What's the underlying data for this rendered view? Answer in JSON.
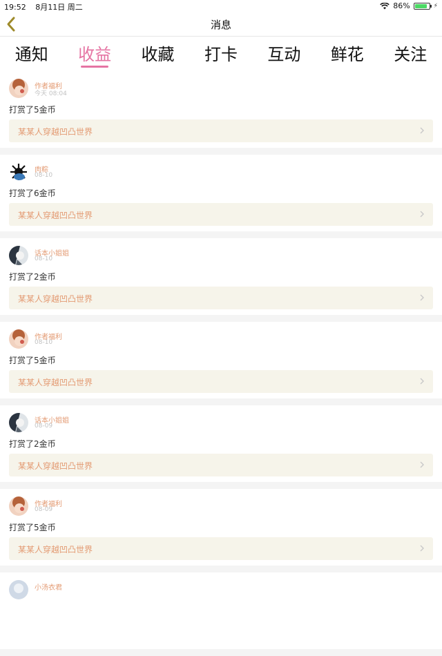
{
  "status": {
    "time": "19:52",
    "date": "8月11日 周二",
    "battery": "86%"
  },
  "nav": {
    "title": "消息",
    "back_icon": "chevron-left-icon"
  },
  "tabs": [
    {
      "label": "通知"
    },
    {
      "label": "收益"
    },
    {
      "label": "收藏"
    },
    {
      "label": "打卡"
    },
    {
      "label": "互动"
    },
    {
      "label": "鲜花"
    },
    {
      "label": "关注"
    }
  ],
  "active_tab": "收益",
  "colors": {
    "accent": "#e574a3",
    "name": "#e39a72",
    "book_bg": "#f6f4ea",
    "battery": "#4cd964"
  },
  "items": [
    {
      "name": "作者福利",
      "time": "今天 08:04",
      "text": "打赏了5金币",
      "book": "某某人穿越凹凸世界"
    },
    {
      "name": "肉粽",
      "time": "08-10",
      "text": "打赏了6金币",
      "book": "某某人穿越凹凸世界"
    },
    {
      "name": "话本小姐姐",
      "time": "08-10",
      "text": "打赏了2金币",
      "book": "某某人穿越凹凸世界"
    },
    {
      "name": "作者福利",
      "time": "08-10",
      "text": "打赏了5金币",
      "book": "某某人穿越凹凸世界"
    },
    {
      "name": "话本小姐姐",
      "time": "08-09",
      "text": "打赏了2金币",
      "book": "某某人穿越凹凸世界"
    },
    {
      "name": "作者福利",
      "time": "08-09",
      "text": "打赏了5金币",
      "book": "某某人穿越凹凸世界"
    },
    {
      "name": "小汤衣君",
      "time": "",
      "text": "",
      "book": ""
    }
  ]
}
